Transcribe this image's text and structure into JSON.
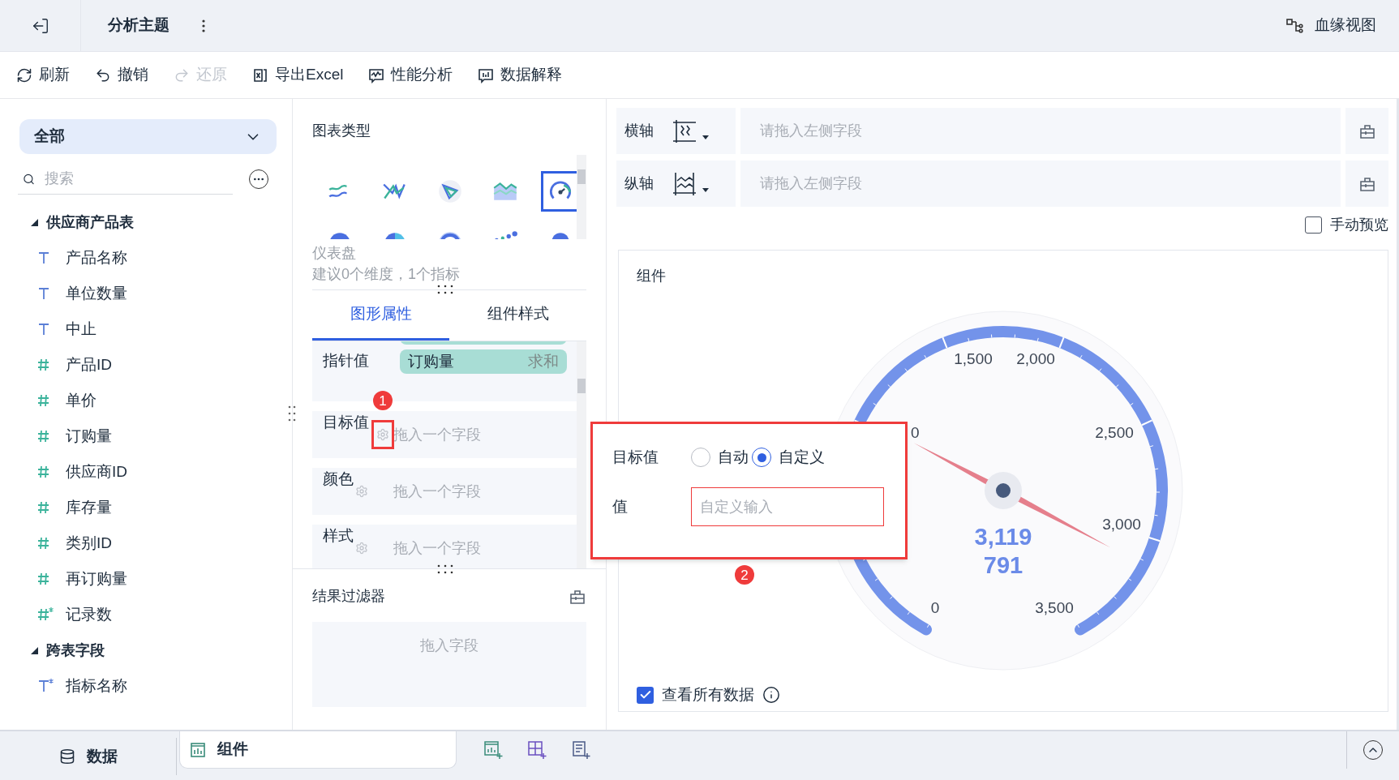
{
  "header": {
    "title": "分析主题",
    "lineage_button": "血缘视图"
  },
  "toolbar": [
    {
      "label": "刷新",
      "kind": "refresh",
      "disabled": false
    },
    {
      "label": "撤销",
      "kind": "undo",
      "disabled": false
    },
    {
      "label": "还原",
      "kind": "redo",
      "disabled": true
    },
    {
      "label": "导出Excel",
      "kind": "excel",
      "disabled": false
    },
    {
      "label": "性能分析",
      "kind": "performance",
      "disabled": false
    },
    {
      "label": "数据解释",
      "kind": "explain",
      "disabled": false
    }
  ],
  "data_panel": {
    "dataset_dropdown": "全部",
    "search": {
      "placeholder": "搜索"
    },
    "groups": [
      {
        "name": "供应商产品表",
        "expanded": true,
        "children": [
          {
            "label": "产品名称",
            "kind": "text"
          },
          {
            "label": "单位数量",
            "kind": "text"
          },
          {
            "label": "中止",
            "kind": "text"
          },
          {
            "label": "产品ID",
            "kind": "number"
          },
          {
            "label": "单价",
            "kind": "number"
          },
          {
            "label": "订购量",
            "kind": "number"
          },
          {
            "label": "供应商ID",
            "kind": "number"
          },
          {
            "label": "库存量",
            "kind": "number"
          },
          {
            "label": "类别ID",
            "kind": "number"
          },
          {
            "label": "再订购量",
            "kind": "number"
          },
          {
            "label": "记录数",
            "kind": "calc_number"
          }
        ]
      },
      {
        "name": "跨表字段",
        "expanded": true,
        "children": [
          {
            "label": "指标名称",
            "kind": "calc_text"
          }
        ]
      }
    ]
  },
  "chart_panel": {
    "title": "图表类型",
    "types": [
      {
        "kind": "multi_line",
        "selected": false
      },
      {
        "kind": "cross_line",
        "selected": false
      },
      {
        "kind": "radar",
        "selected": false
      },
      {
        "kind": "area",
        "selected": false
      },
      {
        "kind": "gauge",
        "selected": true
      },
      {
        "kind": "half_pie",
        "selected": false
      },
      {
        "kind": "pie",
        "selected": false
      },
      {
        "kind": "ring",
        "selected": false
      },
      {
        "kind": "scatter",
        "selected": false
      },
      {
        "kind": "dot",
        "selected": false
      }
    ],
    "selected_name": "仪表盘",
    "hint": "建议0个维度，1个指标",
    "tabs": [
      {
        "label": "图形属性",
        "selected": true
      },
      {
        "label": "组件样式",
        "selected": false
      }
    ],
    "properties": [
      {
        "label": "指针值",
        "fields": [
          {
            "name": "订购量",
            "aggregation": "求和"
          }
        ]
      },
      {
        "label": "目标值",
        "placeholder": "拖入一个字段",
        "annotation": "1"
      },
      {
        "label": "颜色",
        "placeholder": "拖入一个字段"
      },
      {
        "label": "样式",
        "placeholder": "拖入一个字段"
      }
    ],
    "filter": {
      "title": "结果过滤器",
      "placeholder": "拖入字段"
    }
  },
  "axes": [
    {
      "label": "横轴",
      "kind": "x",
      "placeholder": "请拖入左侧字段"
    },
    {
      "label": "纵轴",
      "kind": "y",
      "placeholder": "请拖入左侧字段"
    }
  ],
  "manual_preview": {
    "label": "手动预览",
    "checked": false
  },
  "widget": {
    "title": "组件",
    "gauge": {
      "tick_labels": [
        "0",
        "0",
        "1,500",
        "2,000",
        "2,500",
        "3,000",
        "3,500"
      ],
      "value": "3,119",
      "target": "791"
    },
    "show_all": {
      "label": "查看所有数据",
      "checked": true
    }
  },
  "popup": {
    "annotation": "2",
    "target_label": "目标值",
    "options": [
      {
        "label": "自动",
        "selected": false
      },
      {
        "label": "自定义",
        "selected": true
      }
    ],
    "value_label": "值",
    "value_placeholder": "自定义输入"
  },
  "bottom_tabs": [
    {
      "label": "数据",
      "kind": "data",
      "selected": false
    },
    {
      "label": "组件",
      "kind": "widget",
      "selected": true
    }
  ]
}
